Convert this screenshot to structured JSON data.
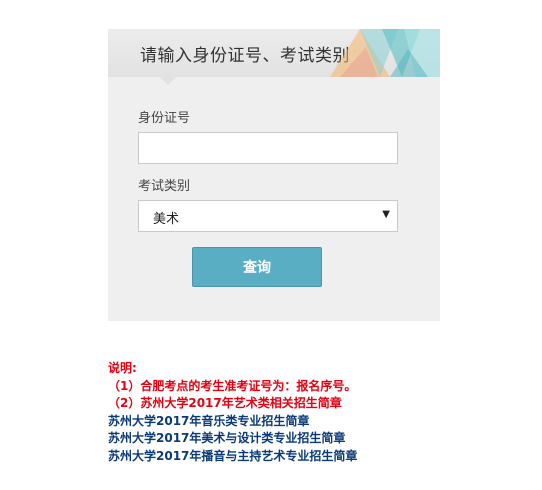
{
  "form": {
    "title": "请输入身份证号、考试类别",
    "id_label": "身份证号",
    "id_value": "",
    "id_placeholder": "",
    "category_label": "考试类别",
    "category_value": "美术",
    "submit_label": "查询"
  },
  "notes": {
    "heading": "说明:",
    "line1": "（1）合肥考点的考生准考证号为：报名序号。",
    "line2": "（2）苏州大学2017年艺术类相关招生简章",
    "links": [
      "苏州大学2017年音乐类专业招生简章",
      "苏州大学2017年美术与设计类专业招生简章",
      "苏州大学2017年播音与主持艺术专业招生简章"
    ]
  },
  "colors": {
    "button": "#5aaec4",
    "note_red": "#e60012",
    "link_blue": "#0a3a78"
  }
}
